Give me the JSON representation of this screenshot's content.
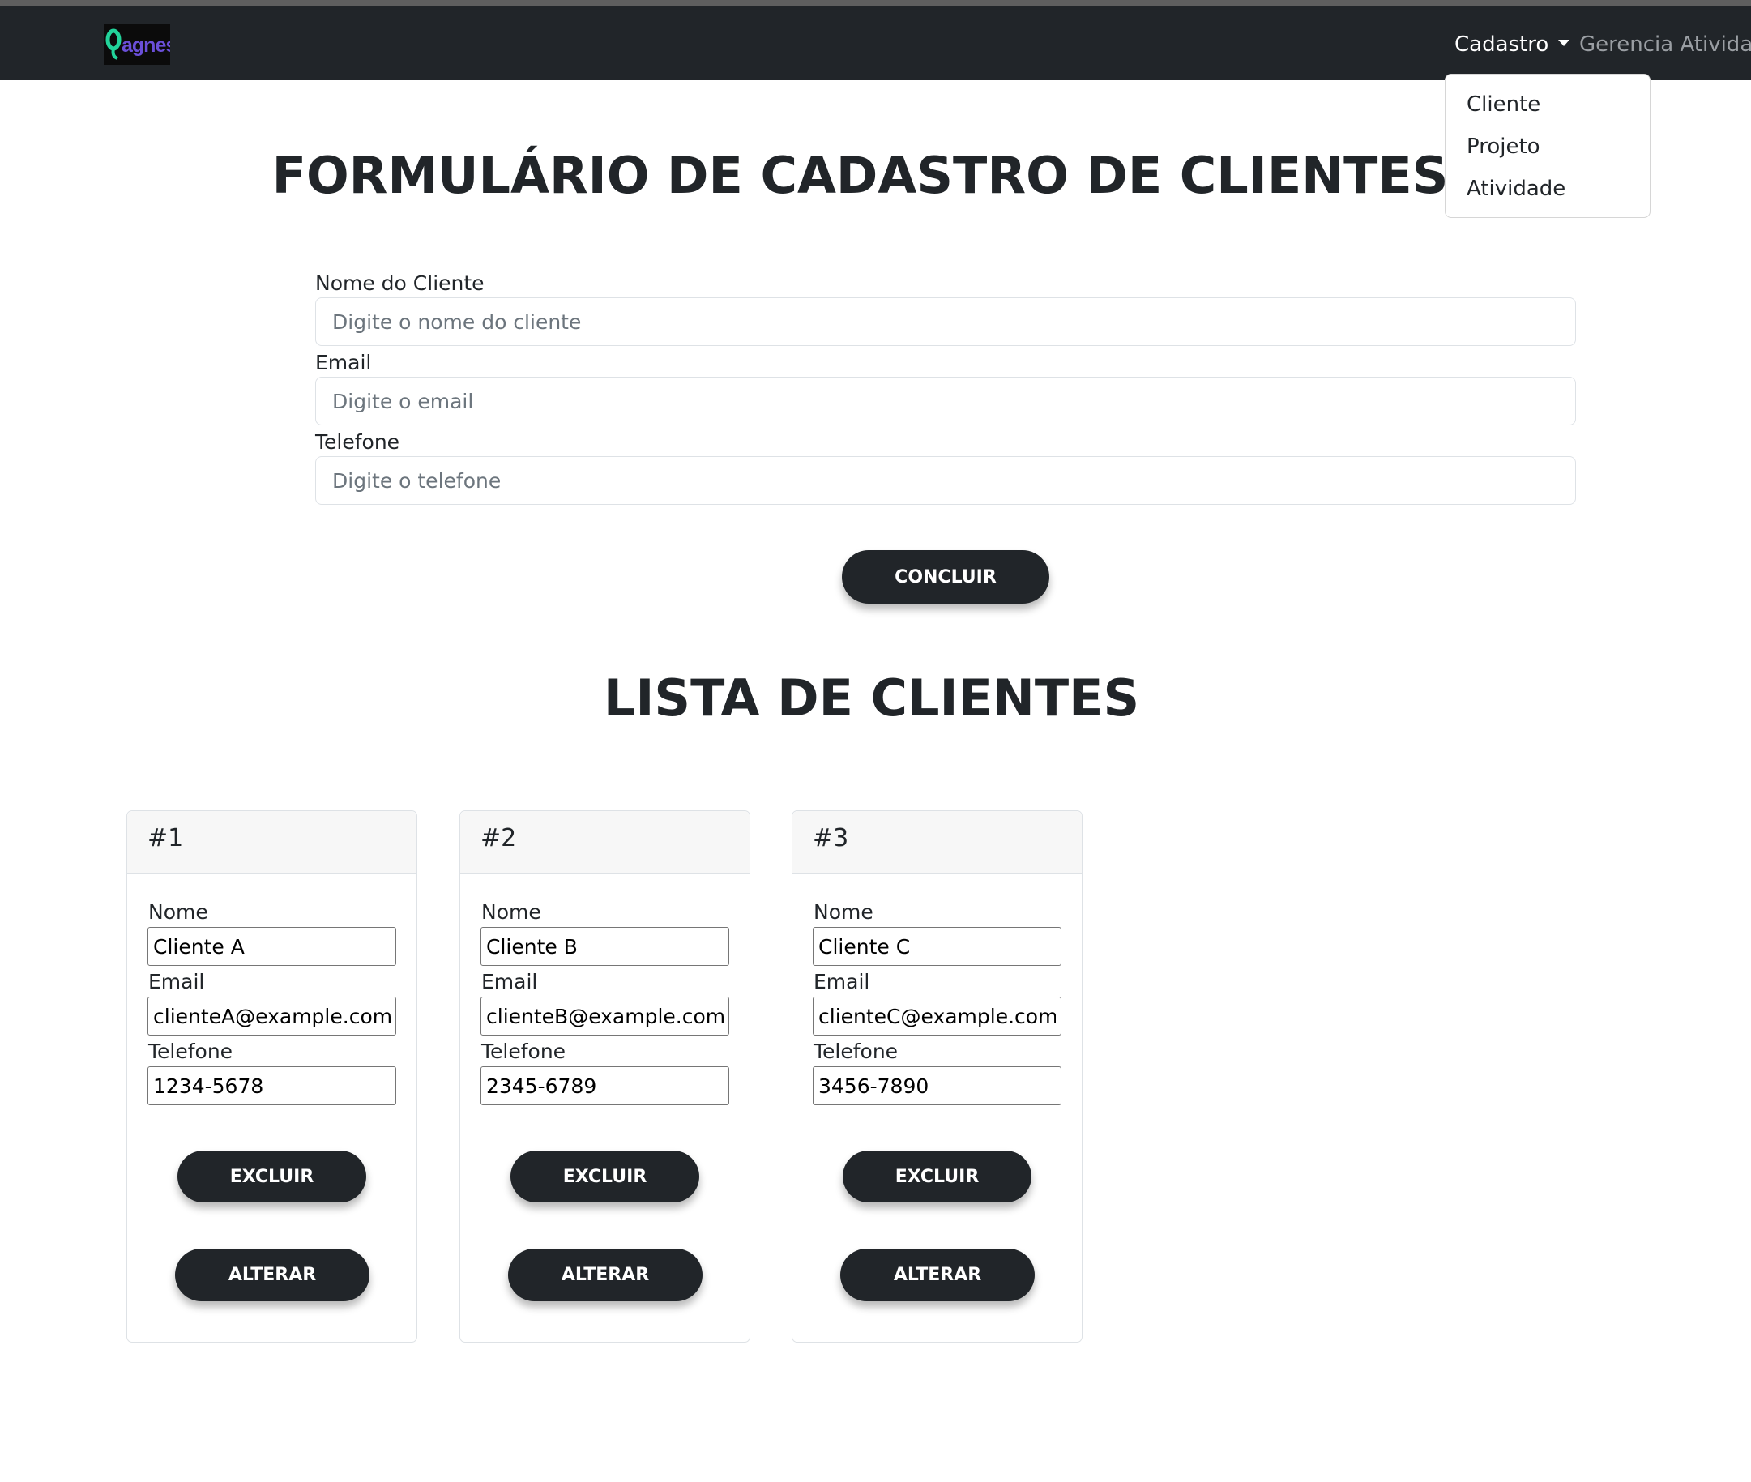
{
  "navbar": {
    "logo_text": "Qagnes",
    "cadastro_label": "Cadastro",
    "gerencia_label": "Gerencia Atividade"
  },
  "dropdown": {
    "items": [
      "Cliente",
      "Projeto",
      "Atividade"
    ]
  },
  "form": {
    "title": "FORMULÁRIO DE CADASTRO DE CLIENTES",
    "nome_label": "Nome do Cliente",
    "nome_placeholder": "Digite o nome do cliente",
    "email_label": "Email",
    "email_placeholder": "Digite o email",
    "telefone_label": "Telefone",
    "telefone_placeholder": "Digite o telefone",
    "submit_label": "CONCLUIR"
  },
  "list": {
    "title": "LISTA DE CLIENTES",
    "field_labels": {
      "nome": "Nome",
      "email": "Email",
      "telefone": "Telefone"
    },
    "delete_label": "EXCLUIR",
    "edit_label": "ALTERAR",
    "clients": [
      {
        "id": "#1",
        "nome": "Cliente A",
        "email": "clienteA@example.com",
        "telefone": "1234-5678"
      },
      {
        "id": "#2",
        "nome": "Cliente B",
        "email": "clienteB@example.com",
        "telefone": "2345-6789"
      },
      {
        "id": "#3",
        "nome": "Cliente C",
        "email": "clienteC@example.com",
        "telefone": "3456-7890"
      }
    ]
  },
  "colors": {
    "navbar_bg": "#212529",
    "button_bg": "#212529",
    "logo_q": "#22d39a",
    "logo_text": "#6a4fd8"
  }
}
